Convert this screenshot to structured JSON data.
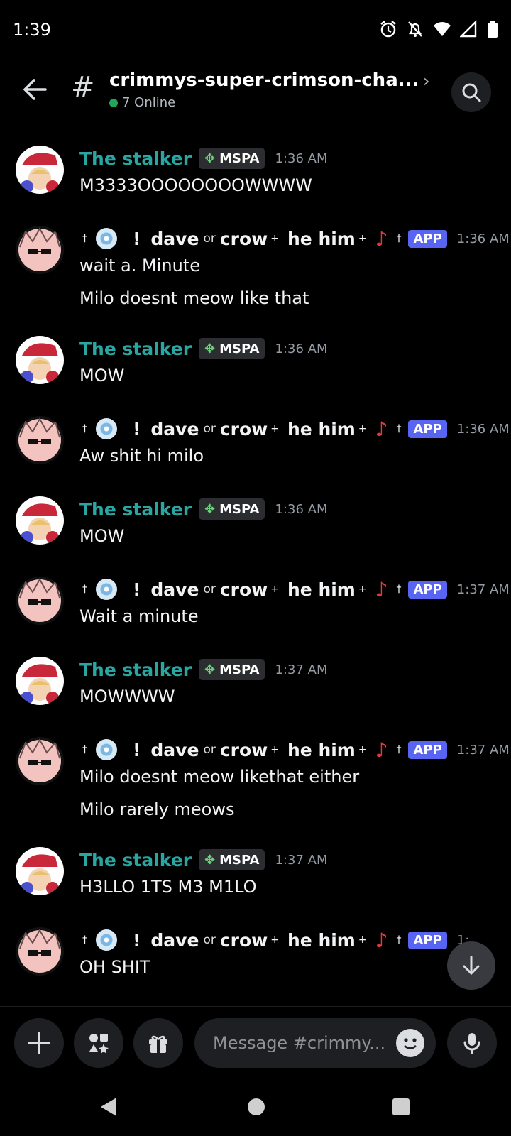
{
  "status_bar": {
    "time": "1:39"
  },
  "header": {
    "channel_name": "crimmys-super-crimson-cha...",
    "online_text": "7 Online"
  },
  "messages": [
    {
      "author": "The stalker",
      "tag": "MSPA",
      "time": "1:36 AM",
      "lines": [
        "M3333OOOOOOOOWWWW"
      ]
    },
    {
      "author": "dave",
      "time": "1:36 AM",
      "lines": [
        "wait a. Minute",
        "Milo doesnt meow like that"
      ]
    },
    {
      "author": "The stalker",
      "tag": "MSPA",
      "time": "1:36 AM",
      "lines": [
        "MOW"
      ]
    },
    {
      "author": "dave",
      "time": "1:36 AM",
      "lines": [
        "Aw shit hi milo"
      ]
    },
    {
      "author": "The stalker",
      "tag": "MSPA",
      "time": "1:36 AM",
      "lines": [
        "MOW"
      ]
    },
    {
      "author": "dave",
      "time": "1:37 AM",
      "lines": [
        "Wait a minute"
      ]
    },
    {
      "author": "The stalker",
      "tag": "MSPA",
      "time": "1:37 AM",
      "lines": [
        "MOWWWW"
      ]
    },
    {
      "author": "dave",
      "time": "1:37 AM",
      "lines": [
        "Milo doesnt meow likethat either",
        "Milo rarely meows"
      ]
    },
    {
      "author": "The stalker",
      "tag": "MSPA",
      "time": "1:37 AM",
      "lines": [
        "H3LLO 1TS M3 M1LO"
      ]
    },
    {
      "author": "dave",
      "time": "1:",
      "lines": [
        "OH SHIT"
      ]
    }
  ],
  "dave_name": {
    "cross": "†",
    "bang": "!",
    "first": "dave",
    "or": "or",
    "second": "crow",
    "plus": "+",
    "pronouns": "he him",
    "app_badge": "APP"
  },
  "composer": {
    "placeholder": "Message #crimmy..."
  },
  "icons": {
    "back": "arrow-left-icon",
    "search": "search-icon",
    "add": "plus-icon",
    "apps": "apps-icon",
    "gift": "gift-icon",
    "emoji": "emoji-icon",
    "mic": "microphone-icon",
    "scroll_down": "arrow-down-icon"
  },
  "colors": {
    "stalker_name": "#2aa6a2",
    "app_badge": "#5865f2",
    "online_dot": "#23a55a"
  }
}
